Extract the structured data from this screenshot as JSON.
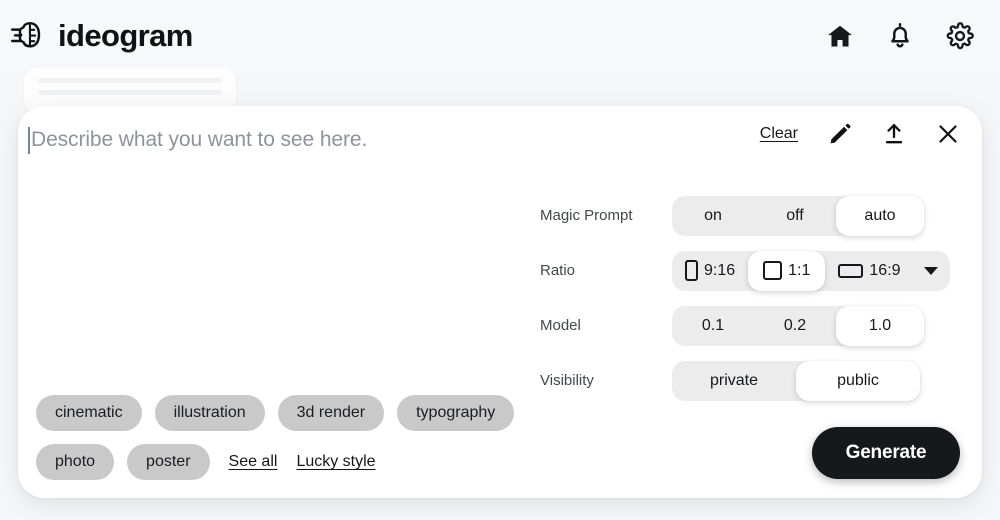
{
  "header": {
    "brand_name": "ideogram",
    "logo_icon": "ideogram-brain-logo",
    "actions": [
      {
        "icon": "home-icon",
        "name": "home-button"
      },
      {
        "icon": "bell-icon",
        "name": "notifications-button"
      },
      {
        "icon": "gear-icon",
        "name": "settings-button"
      }
    ]
  },
  "composer": {
    "prompt": {
      "value": "",
      "placeholder": "Describe what you want to see here."
    },
    "tools": {
      "clear_label": "Clear",
      "edit_icon": "pencil-icon",
      "upload_icon": "upload-icon",
      "close_icon": "close-icon"
    },
    "settings": [
      {
        "label": "Magic Prompt",
        "name": "magic-prompt",
        "options": [
          "on",
          "off",
          "auto"
        ],
        "selected": "auto"
      },
      {
        "label": "Ratio",
        "name": "ratio",
        "options": [
          "9:16",
          "1:1",
          "16:9"
        ],
        "selected": "1:1",
        "has_dropdown": true,
        "dropdown_icon": "chevron-down-icon"
      },
      {
        "label": "Model",
        "name": "model",
        "options": [
          "0.1",
          "0.2",
          "1.0"
        ],
        "selected": "1.0"
      },
      {
        "label": "Visibility",
        "name": "visibility",
        "options": [
          "private",
          "public"
        ],
        "selected": "public"
      }
    ],
    "style_chips_row1": [
      "cinematic",
      "illustration",
      "3d render",
      "typography"
    ],
    "style_chips_row2": [
      "photo",
      "poster"
    ],
    "links": {
      "see_all": "See all",
      "lucky_style": "Lucky style"
    },
    "generate_label": "Generate"
  },
  "colors": {
    "page_background": "#f6f7f9",
    "panel_background": "#ffffff",
    "segment_track": "#ececec",
    "chip_background": "#c9c9c9",
    "accent_dark": "#16181b",
    "placeholder_text": "#8d949c",
    "caret": "#6d8a9b"
  }
}
